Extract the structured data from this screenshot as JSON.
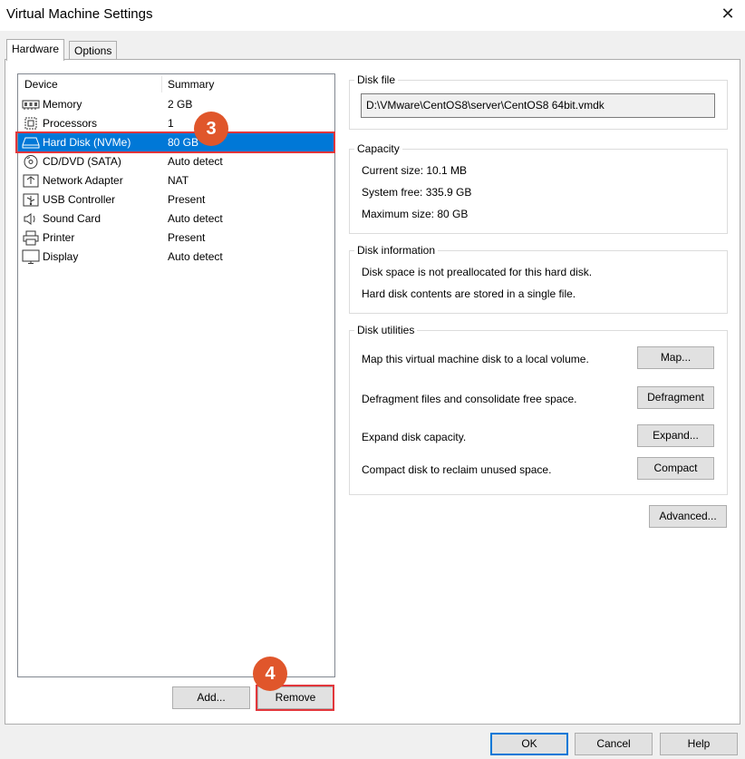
{
  "window": {
    "title": "Virtual Machine Settings"
  },
  "tabs": [
    {
      "label": "Hardware",
      "active": true
    },
    {
      "label": "Options",
      "active": false
    }
  ],
  "device_list": {
    "columns": [
      "Device",
      "Summary"
    ],
    "rows": [
      {
        "icon": "memory-icon",
        "name": "Memory",
        "summary": "2 GB"
      },
      {
        "icon": "processor-icon",
        "name": "Processors",
        "summary": "1"
      },
      {
        "icon": "hard-disk-icon",
        "name": "Hard Disk (NVMe)",
        "summary": "80 GB",
        "selected": true
      },
      {
        "icon": "cd-dvd-icon",
        "name": "CD/DVD (SATA)",
        "summary": "Auto detect"
      },
      {
        "icon": "network-adapter-icon",
        "name": "Network Adapter",
        "summary": "NAT"
      },
      {
        "icon": "usb-icon",
        "name": "USB Controller",
        "summary": "Present"
      },
      {
        "icon": "sound-card-icon",
        "name": "Sound Card",
        "summary": "Auto detect"
      },
      {
        "icon": "printer-icon",
        "name": "Printer",
        "summary": "Present"
      },
      {
        "icon": "display-icon",
        "name": "Display",
        "summary": "Auto detect"
      }
    ]
  },
  "list_buttons": {
    "add": "Add...",
    "remove": "Remove"
  },
  "disk_file": {
    "label": "Disk file",
    "value": "D:\\VMware\\CentOS8\\server\\CentOS8 64bit.vmdk"
  },
  "capacity": {
    "label": "Capacity",
    "current": "Current size: 10.1 MB",
    "system_free": "System free: 335.9 GB",
    "maximum": "Maximum size: 80 GB"
  },
  "disk_information": {
    "label": "Disk information",
    "line1": "Disk space is not preallocated for this hard disk.",
    "line2": "Hard disk contents are stored in a single file."
  },
  "disk_utilities": {
    "label": "Disk utilities",
    "map_text": "Map this virtual machine disk to a local volume.",
    "map_button": "Map...",
    "defrag_text": "Defragment files and consolidate free space.",
    "defrag_button": "Defragment",
    "expand_text": "Expand disk capacity.",
    "expand_button": "Expand...",
    "compact_text": "Compact disk to reclaim unused space.",
    "compact_button": "Compact"
  },
  "advanced_button": "Advanced...",
  "footer": {
    "ok": "OK",
    "cancel": "Cancel",
    "help": "Help"
  },
  "annotations": {
    "step3": "3",
    "step4": "4"
  },
  "colors": {
    "selection": "#0078d7",
    "badge": "#e0562b",
    "highlight_outline": "#e2363b"
  }
}
